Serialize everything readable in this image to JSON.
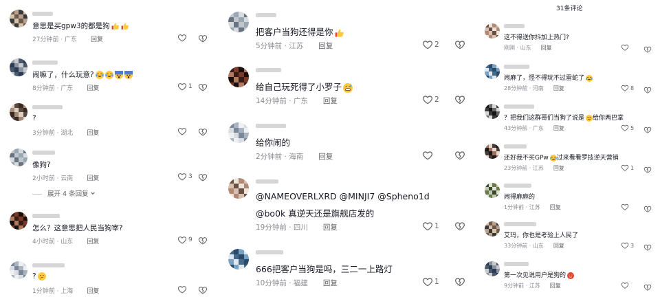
{
  "panel3": {
    "header": "31条评论"
  },
  "comments": {
    "p1": [
      {
        "text": "意思是买gpw3的都是狗",
        "emojis": [
          "thumbs-up",
          "thumbs-up"
        ],
        "time": "27分钟前",
        "loc": "广东",
        "reply": "回复",
        "likes": ""
      },
      {
        "text": "闹嘛了，什么玩意?",
        "emojis": [
          "tears-of-joy",
          "tears-of-joy",
          "scared",
          "scared"
        ],
        "time": "8分钟前",
        "loc": "广东",
        "reply": "回复",
        "likes": "1"
      },
      {
        "text": "?",
        "emojis": [],
        "time": "3分钟前",
        "loc": "湖北",
        "reply": "回复",
        "likes": ""
      },
      {
        "text": "像狗?",
        "emojis": [],
        "time": "2小时前",
        "loc": "云南",
        "reply": "回复",
        "likes": "3"
      },
      {
        "text": "怎么？这意思把人民当狗宰?",
        "emojis": [],
        "time": "4小时前",
        "loc": "山东",
        "reply": "回复",
        "likes": "9"
      },
      {
        "text": "?",
        "emojis": [
          "thinking"
        ],
        "time": "1分钟前",
        "loc": "上海",
        "reply": "回复",
        "likes": ""
      }
    ],
    "p1_expand": "展开 4 条回复",
    "p2": [
      {
        "text": "把客户当狗还得是你",
        "emojis": [
          "thumbs-up"
        ],
        "time": "5分钟前",
        "loc": "江苏",
        "reply": "回复",
        "likes": "2"
      },
      {
        "text": "给自己玩死得了小罗子",
        "emojis": [
          "grin-sweat"
        ],
        "time": "14分钟前",
        "loc": "广东",
        "reply": "回复",
        "likes": "2"
      },
      {
        "text": "给你闹的",
        "emojis": [],
        "time": "2分钟前",
        "loc": "海南",
        "reply": "回复",
        "likes": ""
      },
      {
        "text": "@NAMEOVERLXRD @MINJI7 @Spheno1d",
        "text2": "@bo0k 真逆天还是旗舰店发的",
        "emojis": [],
        "time": "19分钟前",
        "loc": "四川",
        "reply": "回复",
        "likes": "1"
      },
      {
        "text": "666把客户当狗是吗，三二一上路灯",
        "emojis": [],
        "time": "10分钟前",
        "loc": "福建",
        "reply": "回复",
        "likes": "1"
      }
    ],
    "p3": [
      {
        "text": "这不得送你抖加上热门?",
        "emojis": [],
        "time": "刚刚",
        "loc": "山东",
        "reply": "回复",
        "likes": ""
      },
      {
        "text": "闹麻了，怪不得玩不过雷蛇了",
        "emojis": [
          "tears-of-joy"
        ],
        "time": "28分钟前",
        "loc": "河南",
        "reply": "回复",
        "likes": "8"
      },
      {
        "text": "？把我们这群哥们当狗了说是",
        "text2": "给你两巴掌",
        "emojis": [
          "smile"
        ],
        "time": "43分钟前",
        "loc": "广东",
        "reply": "回复",
        "likes": "5"
      },
      {
        "text": "还好我不买GPw",
        "text2": "过来看看罗技逆天营销",
        "emojis": [
          "tears-of-joy"
        ],
        "time": "23分钟前",
        "loc": "江苏",
        "reply": "回复",
        "likes": "1"
      },
      {
        "text": "闹得麻麻的",
        "emojis": [],
        "time": "1分钟前",
        "loc": "江苏",
        "reply": "回复",
        "likes": ""
      },
      {
        "text": "艾玛，你也是考验上人民了",
        "emojis": [],
        "time": "33分钟前",
        "loc": "山东",
        "reply": "回复",
        "likes": "3"
      },
      {
        "text": "第一次见说用户是狗的",
        "emojis": [
          "heart-eyes-devil"
        ],
        "time": "9分钟前",
        "loc": "江苏",
        "reply": "回复",
        "likes": ""
      }
    ]
  },
  "colors": {
    "text": "#161823",
    "meta": "#8a8b91",
    "emoji": "#ffc83d",
    "divider": "#c8c8cc"
  }
}
